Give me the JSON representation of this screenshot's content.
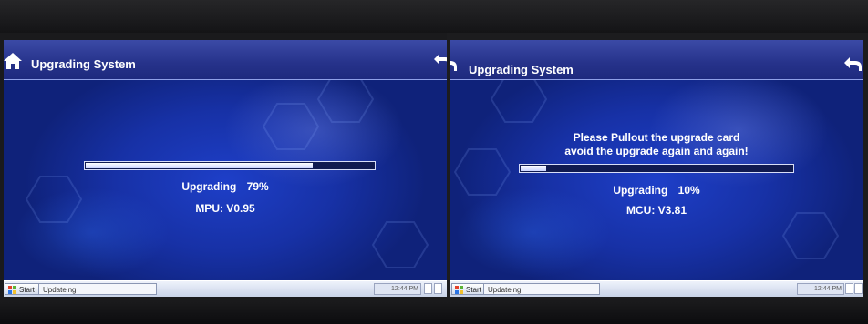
{
  "left_screen": {
    "title": "Upgrading System",
    "progress": 0.79,
    "status_label": "Upgrading",
    "status_percent": "79%",
    "version_text": "MPU: V0.95",
    "taskbar": {
      "start_label": "Start",
      "task_label": "Updateing",
      "clock": "12:44 PM"
    },
    "icons": [
      "home-icon",
      "back-icon"
    ]
  },
  "right_screen": {
    "title": "Upgrading System",
    "notice_line1": "Please Pullout the upgrade card",
    "notice_line2": "avoid the upgrade again and again!",
    "progress": 0.1,
    "status_label": "Upgrading",
    "status_percent": "10%",
    "version_text": "MCU: V3.81",
    "taskbar": {
      "start_label": "Start",
      "task_label": "Updateing",
      "clock": "12:44 PM"
    },
    "icons": [
      "back-icon"
    ]
  },
  "colors": {
    "screen_blue": "#1e3fc8",
    "titlebar": "#26328a",
    "progress_fill": "#ffffff",
    "taskbar": "#dfe5f3"
  }
}
